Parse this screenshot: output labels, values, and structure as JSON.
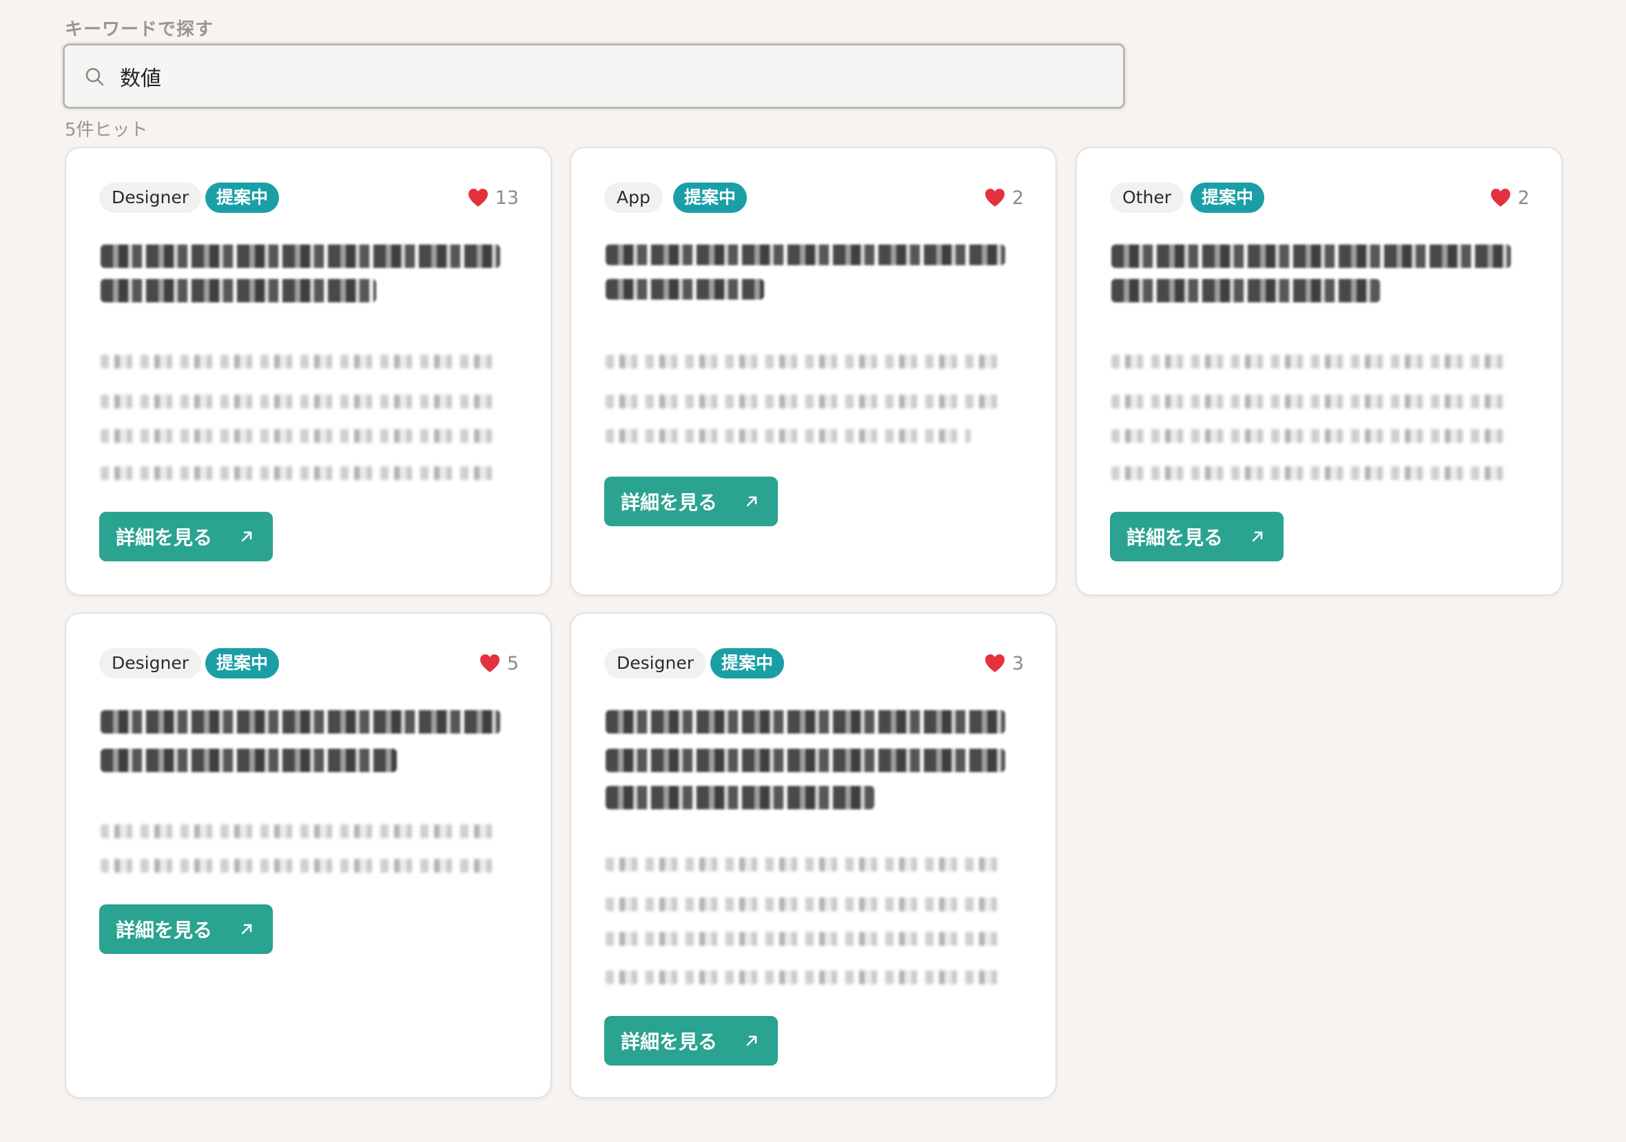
{
  "search": {
    "label": "キーワードで探す",
    "value": "数値",
    "result_count": "5件ヒット"
  },
  "colors": {
    "accent_button": "#2aa391",
    "status_tag": "#1a9fa6",
    "heart": "#e5303e"
  },
  "cards": [
    {
      "category": "Designer",
      "status": "提案中",
      "likes": "13",
      "button_label": "詳細を見る"
    },
    {
      "category": "App",
      "status": "提案中",
      "likes": "2",
      "button_label": "詳細を見る"
    },
    {
      "category": "Other",
      "status": "提案中",
      "likes": "2",
      "button_label": "詳細を見る"
    },
    {
      "category": "Designer",
      "status": "提案中",
      "likes": "5",
      "button_label": "詳細を見る"
    },
    {
      "category": "Designer",
      "status": "提案中",
      "likes": "3",
      "button_label": "詳細を見る"
    }
  ],
  "icons": {
    "search": "search-icon",
    "like": "heart-icon",
    "open": "arrow-up-right-icon"
  }
}
